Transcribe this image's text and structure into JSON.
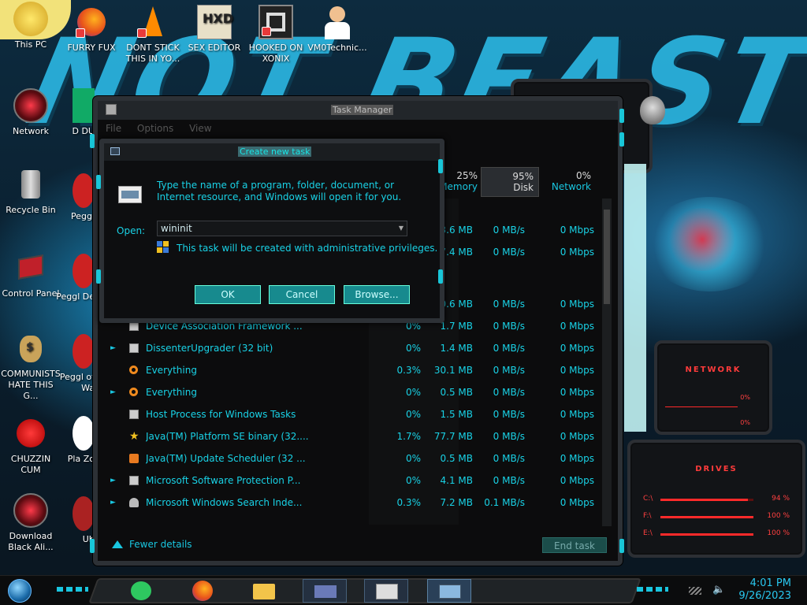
{
  "desktop": {
    "icons": [
      {
        "label": "This PC"
      },
      {
        "label": "FURRY FUX"
      },
      {
        "label": "DONT STICK THIS IN YO..."
      },
      {
        "label": "SEX EDITOR"
      },
      {
        "label": "HOOKED ON XONIX"
      },
      {
        "label": "VM0Technic..."
      },
      {
        "label": "Network"
      },
      {
        "label": "Recycle Bin"
      },
      {
        "label": "Control Panel"
      },
      {
        "label": "COMMUNISTS HATE THIS G..."
      },
      {
        "label": "CHUZZIN CUM"
      },
      {
        "label": "Download Black Ali..."
      },
      {
        "label": "D DU"
      },
      {
        "label": "Peggl"
      },
      {
        "label": "Peggl De"
      },
      {
        "label": "Peggl of Wa"
      },
      {
        "label": "Pla Zo"
      },
      {
        "label": "UK"
      }
    ],
    "wallpaper_word": "NOT BEAST"
  },
  "gadgets": {
    "network": {
      "title": "NETWORK",
      "values": [
        "0%",
        "0%"
      ]
    },
    "drives": {
      "title": "DRIVES",
      "rows": [
        {
          "letter": "C:\\",
          "percent": 94,
          "label": "94 %"
        },
        {
          "letter": "F:\\",
          "percent": 100,
          "label": "100 %"
        },
        {
          "letter": "E:\\",
          "percent": 100,
          "label": "100 %"
        }
      ]
    }
  },
  "taskmgr": {
    "title": "Task Manager",
    "menu": [
      "File",
      "Options",
      "View"
    ],
    "columns": {
      "memory": {
        "pct": "25%",
        "name": "Memory"
      },
      "disk": {
        "pct": "95%",
        "name": "Disk"
      },
      "network": {
        "pct": "0%",
        "name": "Network"
      }
    },
    "rows": [
      {
        "name": "",
        "cpu": "",
        "mem": "3.6 MB",
        "disk": "0 MB/s",
        "net": "0 Mbps",
        "expand": false
      },
      {
        "name": "",
        "cpu": "",
        "mem": "7.4 MB",
        "disk": "0 MB/s",
        "net": "0 Mbps",
        "expand": false
      },
      {
        "name": "",
        "cpu": "",
        "mem": "0.6 MB",
        "disk": "0 MB/s",
        "net": "0 Mbps",
        "expand": false
      },
      {
        "name": "Device Association Framework ...",
        "cpu": "0%",
        "mem": "1.7 MB",
        "disk": "0 MB/s",
        "net": "0 Mbps",
        "expand": false
      },
      {
        "name": "DissenterUpgrader (32 bit)",
        "cpu": "0%",
        "mem": "1.4 MB",
        "disk": "0 MB/s",
        "net": "0 Mbps",
        "expand": true
      },
      {
        "name": "Everything",
        "cpu": "0.3%",
        "mem": "30.1 MB",
        "disk": "0 MB/s",
        "net": "0 Mbps",
        "expand": false
      },
      {
        "name": "Everything",
        "cpu": "0%",
        "mem": "0.5 MB",
        "disk": "0 MB/s",
        "net": "0 Mbps",
        "expand": true
      },
      {
        "name": "Host Process for Windows Tasks",
        "cpu": "0%",
        "mem": "1.5 MB",
        "disk": "0 MB/s",
        "net": "0 Mbps",
        "expand": false
      },
      {
        "name": "Java(TM) Platform SE binary (32....",
        "cpu": "1.7%",
        "mem": "77.7 MB",
        "disk": "0 MB/s",
        "net": "0 Mbps",
        "expand": false
      },
      {
        "name": "Java(TM) Update Scheduler (32 ...",
        "cpu": "0%",
        "mem": "0.5 MB",
        "disk": "0 MB/s",
        "net": "0 Mbps",
        "expand": false
      },
      {
        "name": "Microsoft Software Protection P...",
        "cpu": "0%",
        "mem": "4.1 MB",
        "disk": "0 MB/s",
        "net": "0 Mbps",
        "expand": true
      },
      {
        "name": "Microsoft Windows Search Inde...",
        "cpu": "0.3%",
        "mem": "7.2 MB",
        "disk": "0.1 MB/s",
        "net": "0 Mbps",
        "expand": true
      }
    ],
    "fewer_details": "Fewer details",
    "end_task": "End task"
  },
  "run_dialog": {
    "title": "Create new task",
    "description": "Type the name of a program, folder, document, or Internet resource, and Windows will open it for you.",
    "open_label": "Open:",
    "open_value": "wininit",
    "admin_note": "This task will be created with administrative privileges.",
    "ok": "OK",
    "cancel": "Cancel",
    "browse": "Browse..."
  },
  "taskbar": {
    "time": "4:01 PM",
    "date": "9/26/2023"
  },
  "colors": {
    "accent": "#19c6e0",
    "gadget_red": "#ff2a2a"
  }
}
